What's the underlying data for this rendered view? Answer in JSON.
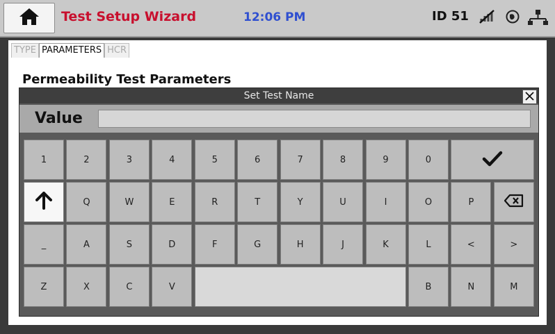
{
  "header": {
    "home_icon": "home-icon",
    "title": "Test Setup Wizard",
    "time": "12:06 PM",
    "device_id": "ID 51",
    "status_icons": [
      "wifi-off-icon",
      "globe-icon",
      "network-icon"
    ],
    "colors": {
      "title": "#c8102e",
      "time": "#2f4fd0"
    }
  },
  "tabs": [
    {
      "label": "TYPE",
      "active": false
    },
    {
      "label": "PARAMETERS",
      "active": true
    },
    {
      "label": "HCR",
      "active": false
    }
  ],
  "page_heading": "Permeability Test Parameters",
  "dialog": {
    "title": "Set Test Name",
    "value_label": "Value",
    "value": "",
    "close_icon": "close-icon"
  },
  "keyboard": {
    "row1": [
      "1",
      "2",
      "3",
      "4",
      "5",
      "6",
      "7",
      "8",
      "9",
      "0"
    ],
    "enter_icon": "checkmark-icon",
    "shift_icon": "shift-up-arrow-icon",
    "row2": [
      "Q",
      "W",
      "E",
      "R",
      "T",
      "Y",
      "U",
      "I",
      "O",
      "P"
    ],
    "backspace_icon": "backspace-icon",
    "row3": [
      "_",
      "A",
      "S",
      "D",
      "F",
      "G",
      "H",
      "J",
      "K",
      "L",
      "<",
      ">"
    ],
    "row4_left": [
      "Z",
      "X",
      "C",
      "V"
    ],
    "row4_right": [
      "B",
      "N",
      "M"
    ]
  }
}
